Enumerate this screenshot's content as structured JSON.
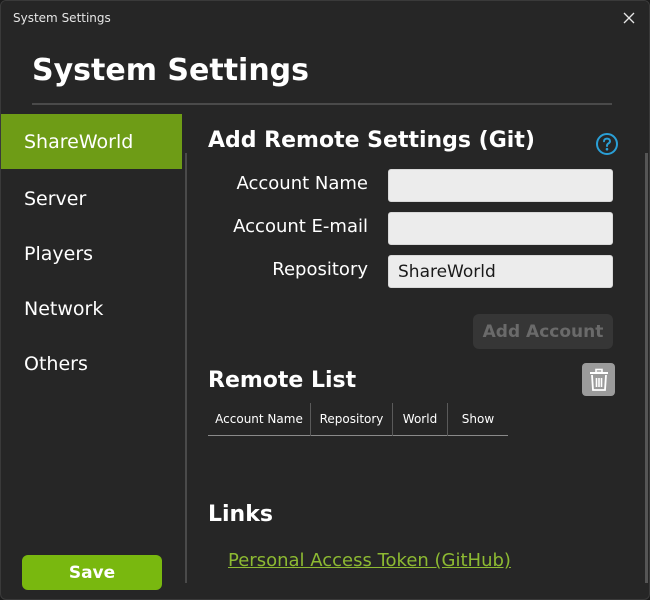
{
  "window": {
    "title": "System Settings"
  },
  "header": {
    "title": "System Settings"
  },
  "sidebar": {
    "items": [
      {
        "label": "ShareWorld",
        "active": true
      },
      {
        "label": "Server",
        "active": false
      },
      {
        "label": "Players",
        "active": false
      },
      {
        "label": "Network",
        "active": false
      },
      {
        "label": "Others",
        "active": false
      }
    ],
    "save_label": "Save"
  },
  "remote_settings": {
    "title": "Add Remote Settings (Git)",
    "help_icon": "question-circle-icon",
    "fields": [
      {
        "label": "Account Name",
        "value": ""
      },
      {
        "label": "Account E-mail",
        "value": ""
      },
      {
        "label": "Repository",
        "value": "ShareWorld"
      }
    ],
    "add_button_label": "Add Account"
  },
  "remote_list": {
    "title": "Remote List",
    "columns": [
      "Account Name",
      "Repository",
      "World",
      "Show"
    ],
    "rows": [],
    "delete_icon": "trash-icon"
  },
  "links": {
    "title": "Links",
    "items": [
      {
        "label": "Personal Access Token (GitHub)"
      }
    ]
  },
  "colors": {
    "accent": "#6e9c16",
    "save_button": "#79b80f",
    "link": "#8dba32",
    "background": "#262626",
    "help_icon": "#2a9fd6"
  }
}
